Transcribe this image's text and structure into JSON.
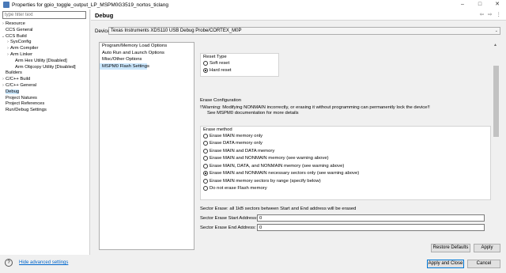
{
  "window": {
    "title": "Properties for gpio_toggle_output_LP_MSPM0G3519_nortos_ticlang",
    "minimize": "–",
    "maximize": "□",
    "close": "✕"
  },
  "filter": {
    "placeholder": "type filter text"
  },
  "tree": [
    {
      "label": "Resource",
      "indent": 1,
      "twisty": "›"
    },
    {
      "label": "CCS General",
      "indent": 1,
      "twisty": ""
    },
    {
      "label": "CCS Build",
      "indent": 1,
      "twisty": "⌄"
    },
    {
      "label": "SysConfig",
      "indent": 2,
      "twisty": "›"
    },
    {
      "label": "Arm Compiler",
      "indent": 2,
      "twisty": "›"
    },
    {
      "label": "Arm Linker",
      "indent": 2,
      "twisty": "›"
    },
    {
      "label": "Arm Hex Utility  [Disabled]",
      "indent": 3,
      "twisty": ""
    },
    {
      "label": "Arm Objcopy Utility  [Disabled]",
      "indent": 3,
      "twisty": ""
    },
    {
      "label": "Builders",
      "indent": 1,
      "twisty": ""
    },
    {
      "label": "C/C++ Build",
      "indent": 1,
      "twisty": "›"
    },
    {
      "label": "C/C++ General",
      "indent": 1,
      "twisty": "›"
    },
    {
      "label": "Debug",
      "indent": 1,
      "twisty": "",
      "selected": true
    },
    {
      "label": "Project Natures",
      "indent": 1,
      "twisty": ""
    },
    {
      "label": "Project References",
      "indent": 1,
      "twisty": ""
    },
    {
      "label": "Run/Debug Settings",
      "indent": 1,
      "twisty": ""
    }
  ],
  "header": {
    "title": "Debug",
    "back": "⇦",
    "fwd": "⇨",
    "menu": "⋮"
  },
  "device": {
    "label": "Device",
    "value": "Texas Instruments XDS110 USB Debug Probe/CORTEX_M0P",
    "arrow": "⌄"
  },
  "sublist": [
    {
      "label": "Program/Memory Load Options"
    },
    {
      "label": "Auto Run and Launch Options"
    },
    {
      "label": "Misc/Other Options"
    },
    {
      "label": "MSPM0 Flash Settings",
      "selected": true
    }
  ],
  "reset": {
    "title": "Reset Type",
    "options": [
      {
        "label": "Soft reset",
        "checked": false
      },
      {
        "label": "Hard reset",
        "checked": true
      }
    ]
  },
  "erase_config": {
    "title": "Erase Configuration",
    "warning": "!!Warning: Modifying NONMAIN incorrectly, or erasing it without programming can permanently lock the device!!",
    "warning2": "See MSPM0 documentation for more details"
  },
  "erase_method": {
    "title": "Erase method",
    "options": [
      {
        "label": "Erase MAIN memory only",
        "checked": false
      },
      {
        "label": "Erase DATA memory only",
        "checked": false
      },
      {
        "label": "Erase MAIN and DATA memory",
        "checked": false
      },
      {
        "label": "Erase MAIN and NONMAIN memory (see warning above)",
        "checked": false
      },
      {
        "label": "Erase MAIN, DATA, and NONMAIN memory (see warning above)",
        "checked": false
      },
      {
        "label": "Erase MAIN and NONMAIN necessary sectors only (see warning above)",
        "checked": true
      },
      {
        "label": "Erase MAIN memory sectors by range (specify below)",
        "checked": false
      },
      {
        "label": "Do not erase Flash memory",
        "checked": false
      }
    ]
  },
  "sector": {
    "note": "Sector Erase: all 1kB sectors between Start and End address will be erased",
    "start_label": "Sector Erase Start Address: 0x",
    "start_value": "0",
    "end_label": "Sector Erase End Address: 0x",
    "end_value": "0"
  },
  "buttons": {
    "restore": "Restore Defaults",
    "apply": "Apply",
    "apply_close": "Apply and Close",
    "cancel": "Cancel"
  },
  "footer": {
    "help": "?",
    "hide_advanced": "Hide advanced settings"
  }
}
